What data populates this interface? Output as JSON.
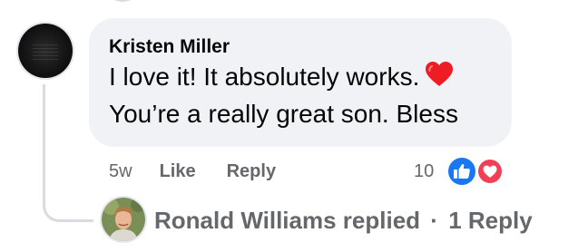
{
  "comment": {
    "author": "Kristen Miller",
    "line1": "I love it! It absolutely works.",
    "line2": "You’re a really great son. Bless"
  },
  "actions": {
    "time": "5w",
    "like_label": "Like",
    "reply_label": "Reply",
    "reaction_count": "10",
    "reactions": [
      "like-icon",
      "love-icon"
    ]
  },
  "reply": {
    "summary": "Ronald Williams replied",
    "separator": "·",
    "count_label": "1 Reply"
  },
  "colors": {
    "bubble": "#f0f2f5",
    "muted_text": "#65676b",
    "like_blue": "#1877f2",
    "love_red": "#f33e58"
  }
}
